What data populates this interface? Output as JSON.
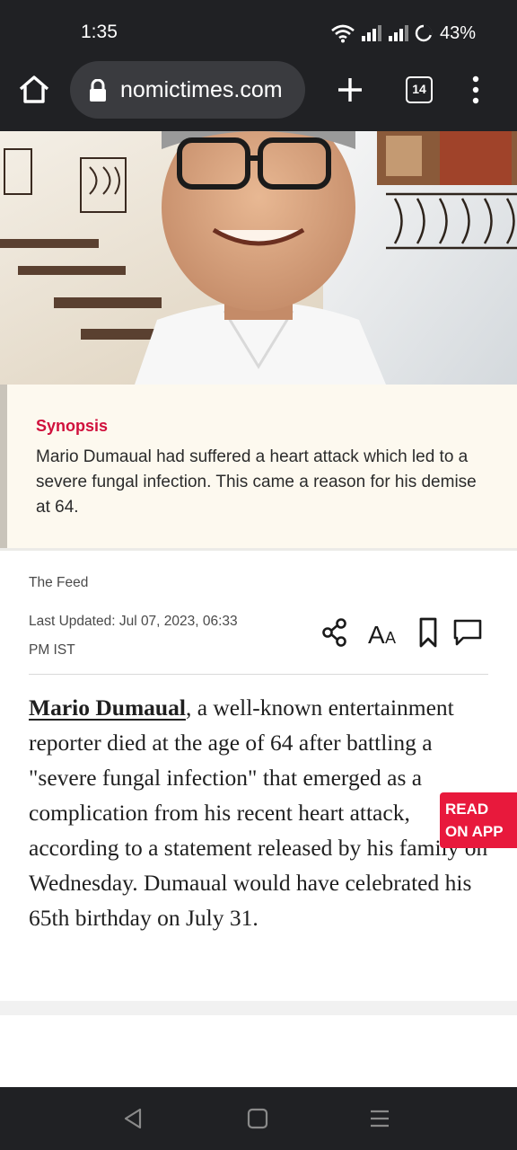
{
  "status_bar": {
    "time": "1:35",
    "battery": "43%"
  },
  "browser": {
    "url": "nomictimes.com",
    "tab_count": "14"
  },
  "synopsis": {
    "title": "Synopsis",
    "text": "Mario Dumaual had suffered a heart attack which led to a severe fungal infection. This came a reason for his demise at 64."
  },
  "article": {
    "section": "The Feed",
    "last_updated": "Last Updated: Jul 07, 2023, 06:33 PM IST",
    "author_link": "Mario Dumaual",
    "body": ", a well-known entertainment reporter died at the age of 64 after battling a \"severe fungal infection\" that emerged as a complication from his recent heart attack, according to a statement released by his family on Wednesday. Dumaual would have celebrated his 65th birthday on July 31."
  },
  "read_on_app": {
    "line1": "READ",
    "line2": "ON APP"
  },
  "icons": {
    "home": "home-icon",
    "lock": "lock-icon",
    "new_tab": "plus-icon",
    "menu": "more-vert-icon",
    "share": "share-icon",
    "font_size": "font-size-icon",
    "bookmark": "bookmark-icon",
    "comment": "comment-icon"
  },
  "colors": {
    "accent": "#d0103c",
    "read_app": "#e8193c",
    "chrome": "#202124"
  }
}
